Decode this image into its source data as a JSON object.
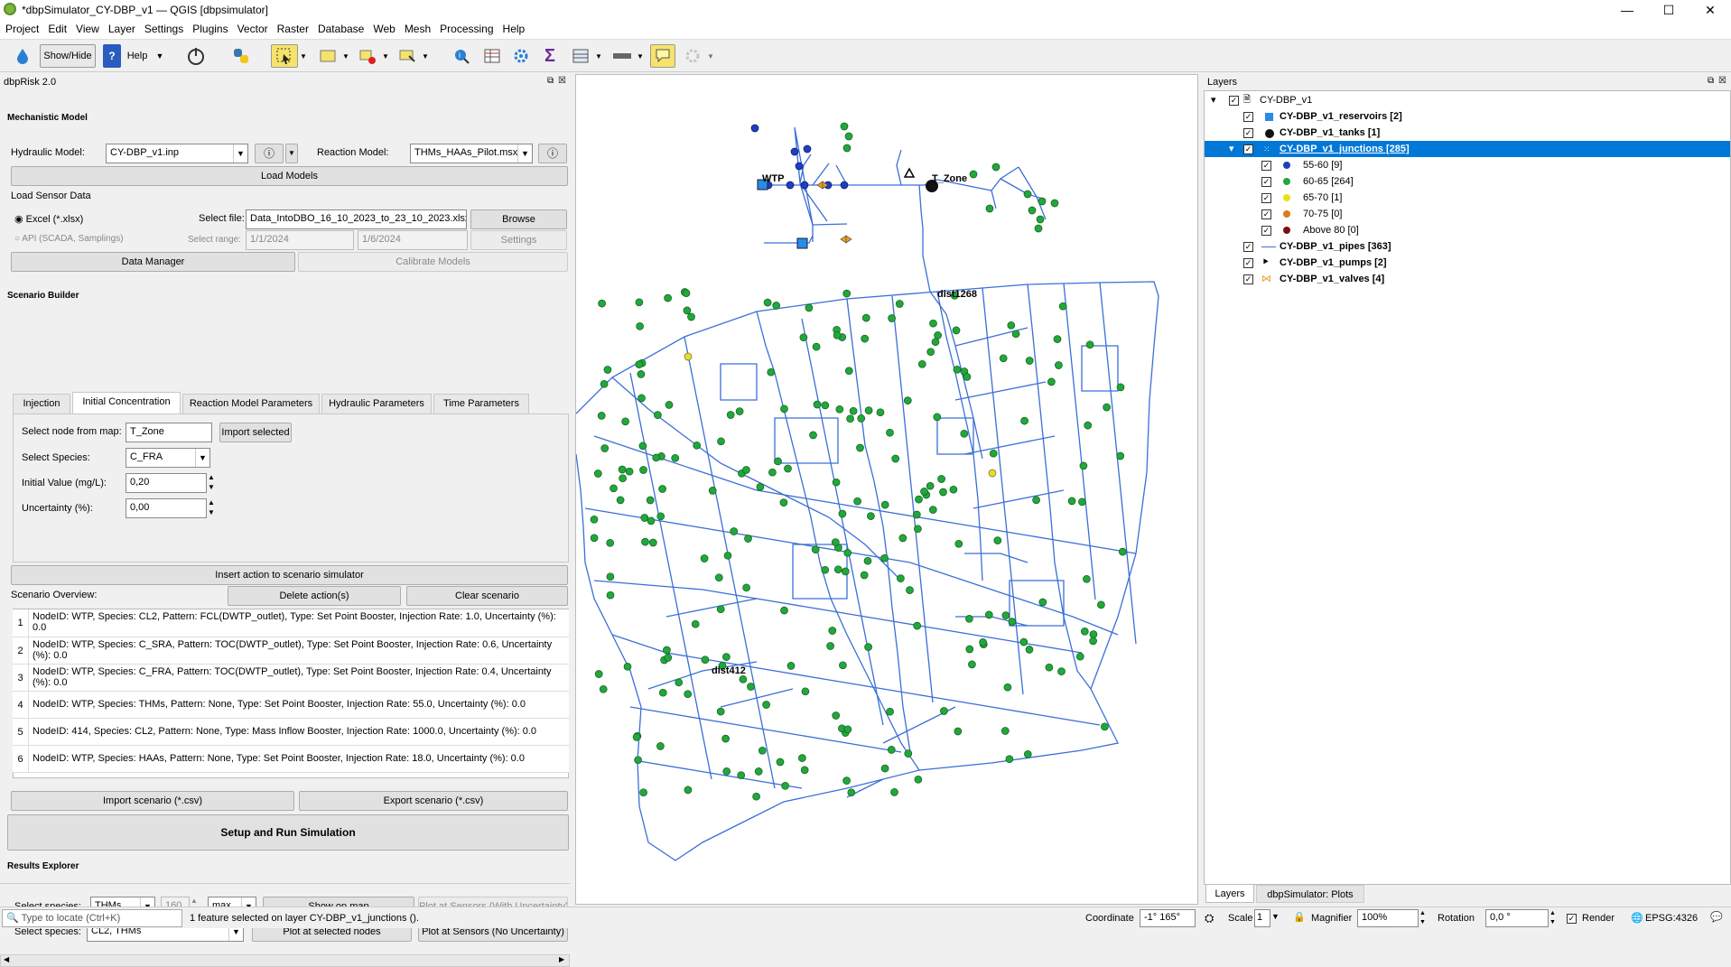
{
  "window": {
    "title": "*dbpSimulator_CY-DBP_v1 — QGIS [dbpsimulator]",
    "min": "—",
    "max": "☐",
    "close": "✕"
  },
  "menu": [
    "Project",
    "Edit",
    "View",
    "Layer",
    "Settings",
    "Plugins",
    "Vector",
    "Raster",
    "Database",
    "Web",
    "Mesh",
    "Processing",
    "Help"
  ],
  "toolbar": {
    "showhide": "Show/Hide",
    "help": "Help"
  },
  "panel": {
    "title": "dbpRisk 2.0",
    "mechanistic": "Mechanistic Model",
    "hydraulic_label": "Hydraulic Model:",
    "hydraulic_value": "CY-DBP_v1.inp",
    "reaction_label": "Reaction Model:",
    "reaction_value": "THMs_HAAs_Pilot.msx",
    "load_models": "Load Models",
    "sensor_title": "Load Sensor Data",
    "excel": "Excel (*.xlsx)",
    "api": "API (SCADA, Samplings)",
    "select_file": "Select file:",
    "file_value": "Data_IntoDBO_16_10_2023_to_23_10_2023.xlsx",
    "browse": "Browse",
    "select_range": "Select range:",
    "range_from": "1/1/2024",
    "range_to": "1/6/2024",
    "settings": "Settings",
    "data_manager": "Data Manager",
    "calibrate": "Calibrate Models",
    "scenario_builder": "Scenario Builder",
    "tabs": [
      "Injection",
      "Initial Concentration",
      "Reaction Model Parameters",
      "Hydraulic Parameters",
      "Time Parameters"
    ],
    "select_node": "Select node from map:",
    "node_value": "T_Zone",
    "import_selected": "Import selected",
    "select_species": "Select Species:",
    "species_value": "C_FRA",
    "initial_value": "Initial Value (mg/L):",
    "initial_num": "0,20",
    "uncertainty": "Uncertainty (%):",
    "uncertainty_num": "0,00",
    "insert_action": "Insert action to scenario simulator",
    "scenario_overview": "Scenario Overview:",
    "delete_actions": "Delete action(s)",
    "clear_scenario": "Clear scenario",
    "rows": [
      {
        "n": "1",
        "t": "NodeID: WTP, Species: CL2, Pattern: FCL(DWTP_outlet), Type: Set Point Booster, Injection Rate: 1.0, Uncertainty (%): 0.0"
      },
      {
        "n": "2",
        "t": "NodeID: WTP, Species: C_SRA, Pattern: TOC(DWTP_outlet), Type: Set Point Booster, Injection Rate: 0.6, Uncertainty (%): 0.0"
      },
      {
        "n": "3",
        "t": "NodeID: WTP, Species: C_FRA, Pattern: TOC(DWTP_outlet), Type: Set Point Booster, Injection Rate: 0.4, Uncertainty (%): 0.0"
      },
      {
        "n": "4",
        "t": "NodeID: WTP, Species: THMs, Pattern: None, Type: Set Point Booster, Injection Rate: 55.0, Uncertainty (%): 0.0"
      },
      {
        "n": "5",
        "t": "NodeID: 414, Species: CL2, Pattern: None, Type: Mass Inflow Booster, Injection Rate: 1000.0, Uncertainty (%): 0.0"
      },
      {
        "n": "6",
        "t": "NodeID: WTP, Species: HAAs, Pattern: None, Type: Set Point Booster, Injection Rate: 18.0, Uncertainty (%): 0.0"
      }
    ],
    "import_scenario": "Import scenario (*.csv)",
    "export_scenario": "Export scenario (*.csv)",
    "setup_run": "Setup and Run Simulation",
    "results_explorer": "Results Explorer",
    "sel_species1": "Select species:",
    "species1": "THMs",
    "spin1": "160",
    "agg": "max",
    "show_on_map": "Show on map",
    "plot_sensors_unc": "Plot at Sensors (With Uncertainty)",
    "sel_species2": "Select species:",
    "species2": "CL2, THMs",
    "plot_selected": "Plot at selected nodes",
    "plot_sensors_no": "Plot at Sensors (No Uncertainty)"
  },
  "map": {
    "labels": [
      "WTP",
      "T_Zone",
      "dist1268",
      "dist412"
    ]
  },
  "layers": {
    "title": "Layers",
    "group": "CY-DBP_v1",
    "items": [
      {
        "name": "CY-DBP_v1_reservoirs [2]"
      },
      {
        "name": "CY-DBP_v1_tanks [1]"
      },
      {
        "name": "CY-DBP_v1_junctions [285]"
      },
      {
        "name": "CY-DBP_v1_pipes [363]"
      },
      {
        "name": "CY-DBP_v1_pumps [2]"
      },
      {
        "name": "CY-DBP_v1_valves [4]"
      }
    ],
    "classes": [
      {
        "label": "55-60 [9]",
        "color": "#1f3fbf"
      },
      {
        "label": "60-65 [264]",
        "color": "#1fa83c"
      },
      {
        "label": "65-70 [1]",
        "color": "#e8e01a"
      },
      {
        "label": "70-75 [0]",
        "color": "#e07a1a"
      },
      {
        "label": "Above 80 [0]",
        "color": "#7a1010"
      }
    ],
    "tab_layers": "Layers",
    "tab_plots": "dbpSimulator: Plots"
  },
  "status": {
    "locate": "Type to locate (Ctrl+K)",
    "message": "1 feature selected on layer CY-DBP_v1_junctions ().",
    "coordinate_label": "Coordinate",
    "coordinate": "-1° 165°",
    "scale_label": "Scale",
    "scale": "1",
    "magnifier_label": "Magnifier",
    "magnifier": "100%",
    "rotation_label": "Rotation",
    "rotation": "0,0 °",
    "render": "Render",
    "epsg": "EPSG:4326"
  }
}
